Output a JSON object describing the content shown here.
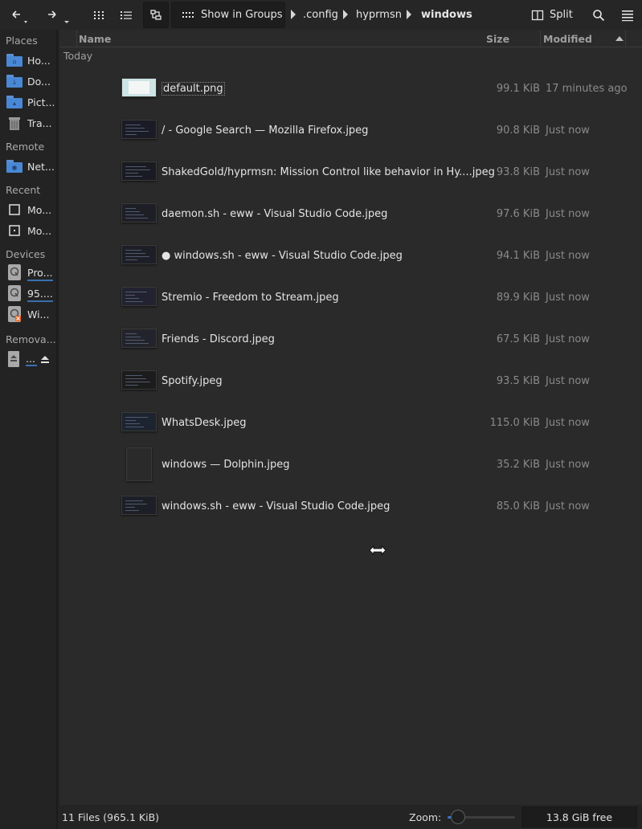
{
  "toolbar": {
    "show_in_groups_label": "Show in Groups",
    "split_label": "Split",
    "breadcrumb": [
      ".config",
      "hyprmsn",
      "windows"
    ]
  },
  "sidebar": {
    "sections": {
      "places": "Places",
      "remote": "Remote",
      "recent": "Recent",
      "devices": "Devices",
      "removable": "Remova..."
    },
    "places": [
      {
        "label": "Ho...",
        "icon": "home-folder-icon"
      },
      {
        "label": "Do...",
        "icon": "downloads-folder-icon"
      },
      {
        "label": "Pict...",
        "icon": "pictures-folder-icon"
      },
      {
        "label": "Tra...",
        "icon": "trash-icon"
      }
    ],
    "remote": [
      {
        "label": "Net...",
        "icon": "network-folder-icon"
      }
    ],
    "recent": [
      {
        "label": "Mo...",
        "icon": "recent-files-icon"
      },
      {
        "label": "Mo...",
        "icon": "recent-locations-icon"
      }
    ],
    "devices": [
      {
        "label": "Pro...",
        "icon": "drive-icon",
        "usage": 0.8
      },
      {
        "label": "95....",
        "icon": "drive-icon",
        "usage": 0.9
      },
      {
        "label": "Wi...",
        "icon": "drive-error-icon"
      }
    ],
    "removable": [
      {
        "label": "...",
        "icon": "removable-drive-icon"
      }
    ]
  },
  "columns": {
    "name": "Name",
    "size": "Size",
    "modified": "Modified"
  },
  "group_label": "Today",
  "files": [
    {
      "name": "default.png",
      "size": "99.1 KiB",
      "modified": "17 minutes ago"
    },
    {
      "name": "/ - Google Search — Mozilla Firefox.jpeg",
      "size": "90.8 KiB",
      "modified": "Just now"
    },
    {
      "name": "ShakedGold/hyprmsn: Mission Control like behavior in Hy....jpeg",
      "size": "93.8 KiB",
      "modified": "Just now"
    },
    {
      "name": "daemon.sh - eww - Visual Studio Code.jpeg",
      "size": "97.6 KiB",
      "modified": "Just now"
    },
    {
      "name": "● windows.sh - eww - Visual Studio Code.jpeg",
      "size": "94.1 KiB",
      "modified": "Just now"
    },
    {
      "name": "Stremio - Freedom to Stream.jpeg",
      "size": "89.9 KiB",
      "modified": "Just now"
    },
    {
      "name": "Friends - Discord.jpeg",
      "size": "67.5 KiB",
      "modified": "Just now"
    },
    {
      "name": "Spotify.jpeg",
      "size": "93.5 KiB",
      "modified": "Just now"
    },
    {
      "name": "WhatsDesk.jpeg",
      "size": "115.0 KiB",
      "modified": "Just now"
    },
    {
      "name": "windows — Dolphin.jpeg",
      "size": "35.2 KiB",
      "modified": "Just now"
    },
    {
      "name": "windows.sh - eww - Visual Studio Code.jpeg",
      "size": "85.0 KiB",
      "modified": "Just now"
    }
  ],
  "status": {
    "summary": "11 Files (965.1 KiB)",
    "zoom_label": "Zoom:",
    "zoom_level": 0.15,
    "free_space": "13.8 GiB free"
  },
  "colors": {
    "accent": "#3a74c4",
    "folder": "#4a88d6",
    "background": "#2a2a2a"
  }
}
